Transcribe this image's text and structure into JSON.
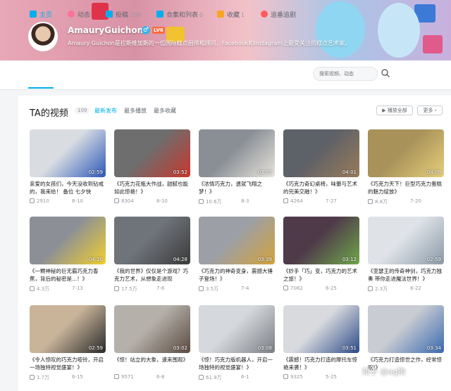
{
  "profile": {
    "username": "AmauryGuichon",
    "gender_symbol": "♂",
    "level": "LV6",
    "bio": "Amaury Guichon是拉斯维加斯的一位国际糕点厨师和顾问。Facebook和Instagram上最受关注的糕点艺术家。"
  },
  "nav": {
    "items": [
      {
        "label": "主页",
        "count": "",
        "icon": "home-icon",
        "color": "#00aeec"
      },
      {
        "label": "动态",
        "count": "",
        "icon": "dynamic-icon",
        "color": "#fb7299"
      },
      {
        "label": "投稿",
        "count": "109",
        "icon": "upload-icon",
        "color": "#00aeec"
      },
      {
        "label": "合集和列表",
        "count": "0",
        "icon": "collection-icon",
        "color": "#00aeec"
      },
      {
        "label": "收藏",
        "count": "1",
        "icon": "star-icon",
        "color": "#f6a623"
      },
      {
        "label": "追番追剧",
        "count": "",
        "icon": "heart-icon",
        "color": "#ff5a5a"
      }
    ],
    "search_placeholder": "搜索视频、动态"
  },
  "section": {
    "title": "TA的视频",
    "count": "109",
    "sorts": [
      "最新发布",
      "最多播放",
      "最多收藏"
    ],
    "play_all": "▶ 播放全部",
    "more": "更多 ›"
  },
  "videos": [
    {
      "title": "亲爱的女孩们，今天没收到钻戒的，我来给！ 备位 七夕快",
      "duration": "02:59",
      "plays": "2910",
      "date": "8-10",
      "c1": "#d9dde2",
      "c2": "#2d58b8"
    },
    {
      "title": "《巧克力花瓶大作战，甜腻也能如此惊艳！》",
      "duration": "03:52",
      "plays": "8304",
      "date": "8-10",
      "c1": "#6e6e6e",
      "c2": "#c8372d"
    },
    {
      "title": "《浓情巧克力，遗就飞翔之梦！》",
      "duration": "03:55",
      "plays": "10.6万",
      "date": "8-3",
      "c1": "#8a8f96",
      "c2": "#e8e4dc"
    },
    {
      "title": "《巧克力奇幻桌椅，味蕾与艺术的完美交融！》",
      "duration": "04:01",
      "plays": "4264",
      "date": "7-27",
      "c1": "#5d6168",
      "c2": "#9a7b5a"
    },
    {
      "title": "《巧克力天下！巨型巧克力蛋糕的魅力绽放》",
      "duration": "04:09",
      "plays": "8.8万",
      "date": "7-20",
      "c1": "#a8925a",
      "c2": "#e6cf7a"
    },
    {
      "title": "《一颗神秘的巨无霸巧克力香蕉，背后的秘密是...！》",
      "duration": "04:20",
      "plays": "4.3万",
      "date": "7-13",
      "c1": "#8c9096",
      "c2": "#f2cf2e"
    },
    {
      "title": "《我的世界》仅仅是个游戏？巧克力艺术，从想象走进现",
      "duration": "04:28",
      "plays": "17.5万",
      "date": "7-6",
      "c1": "#6f737a",
      "c2": "#3a3a3a"
    },
    {
      "title": "《巧克力的神奇变身，震撼大锤子登场！》",
      "duration": "03:39",
      "plays": "3.5万",
      "date": "7-4",
      "c1": "#9ca0a6",
      "c2": "#d4a23a"
    },
    {
      "title": "《妙手「巧」变，巧克力的艺术之旅！》",
      "duration": "03:12",
      "plays": "7082",
      "date": "6-25",
      "c1": "#4f3a4a",
      "c2": "#6fa84a"
    },
    {
      "title": "《亚瑟王的传奇神剑，巧克力独奏 带你走进魔法世界！》",
      "duration": "02:59",
      "plays": "2.3万",
      "date": "6-22",
      "c1": "#dfe3e8",
      "c2": "#8a9aa8"
    },
    {
      "title": "《令人惊叹的巧克力哑铃，开启一场独特视觉盛宴！》",
      "duration": "02:59",
      "plays": "1.7万",
      "date": "6-15",
      "c1": "#c9b49a",
      "c2": "#2a2a2a"
    },
    {
      "title": "《惊！站立的大象，速来围观》",
      "duration": "03:02",
      "plays": "9571",
      "date": "6-8",
      "c1": "#b5b1aa",
      "c2": "#5a4a40"
    },
    {
      "title": "《惊！巧克力版机器人，开启一场独特的视觉盛宴！》",
      "duration": "03:08",
      "plays": "61.9万",
      "date": "6-1",
      "c1": "#d5d8dc",
      "c2": "#7a7e84"
    },
    {
      "title": "《震撼！巧克力打造的摩托车惊艳来袭！》",
      "duration": "03:51",
      "plays": "9325",
      "date": "5-25",
      "c1": "#d8dadd",
      "c2": "#2c4a8a"
    },
    {
      "title": "《巧克力打造惊世之作，经常惊叹!》",
      "duration": "03:34",
      "plays": "",
      "date": "",
      "c1": "#c9ccd2",
      "c2": "#3a6ab0"
    }
  ],
  "watermark": "知乎 @ag狗"
}
